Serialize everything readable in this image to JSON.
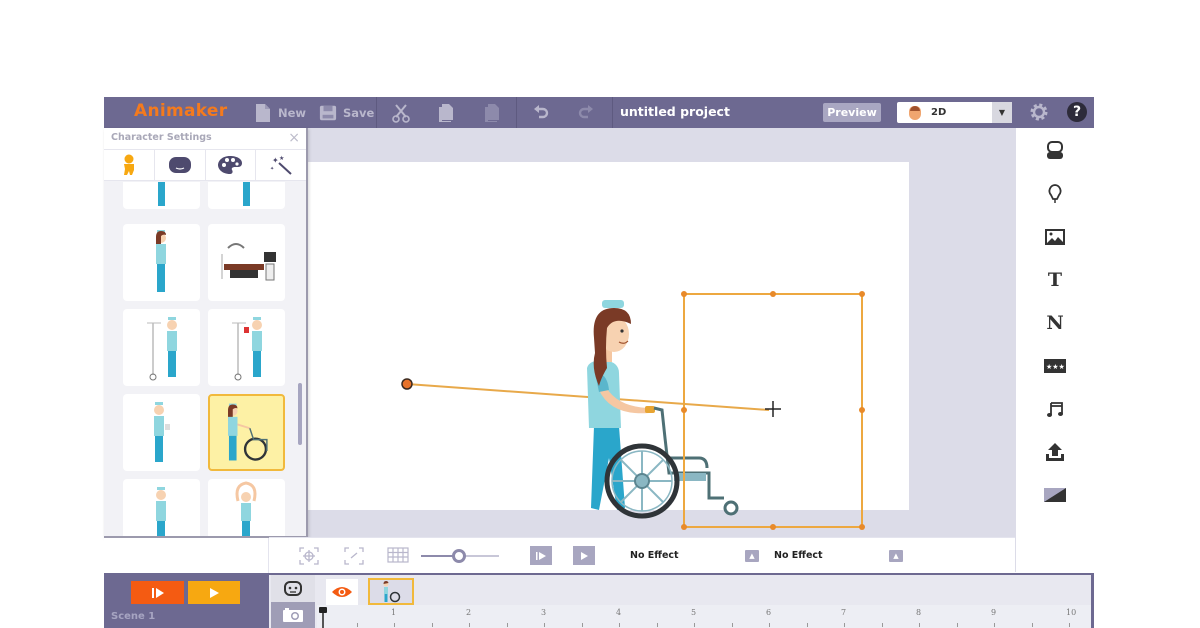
{
  "app": {
    "logo": "Animaker",
    "project_title": "untitled project",
    "colors": {
      "topbar": "#6d6991",
      "accent_orange": "#f45b12",
      "accent_yellow": "#f7a811",
      "selection": "#f1b93c"
    }
  },
  "toolbar": {
    "new_label": "New",
    "save_label": "Save",
    "cut_icon": "scissors-icon",
    "copy_icon": "copy-icon",
    "paste_icon": "paste-icon",
    "undo_icon": "undo-icon",
    "redo_icon": "redo-icon",
    "preview_label": "Preview",
    "mode_value": "2D",
    "settings_icon": "gear-icon",
    "help_label": "?"
  },
  "character_panel": {
    "title": "Character Settings",
    "close_label": "×",
    "tabs": [
      {
        "name": "actions",
        "icon": "character-icon"
      },
      {
        "name": "face",
        "icon": "face-icon"
      },
      {
        "name": "color",
        "icon": "palette-icon"
      },
      {
        "name": "effects",
        "icon": "magic-wand-icon"
      }
    ],
    "items": [
      {
        "label": "nurse standing legs (partial)",
        "selected": false
      },
      {
        "label": "nurse standing legs (partial)",
        "selected": false
      },
      {
        "label": "nurse standing",
        "selected": false
      },
      {
        "label": "operating room equipment",
        "selected": false
      },
      {
        "label": "nurse with IV stand",
        "selected": false
      },
      {
        "label": "nurse with IV stand holding item",
        "selected": false
      },
      {
        "label": "nurse holding cup",
        "selected": false
      },
      {
        "label": "nurse pushing wheelchair",
        "selected": true
      },
      {
        "label": "nurse writing",
        "selected": false
      },
      {
        "label": "nurse arms raised",
        "selected": false
      }
    ]
  },
  "right_sidebar": {
    "items": [
      {
        "name": "characters",
        "icon": "character-head-icon"
      },
      {
        "name": "props",
        "icon": "lightbulb-icon"
      },
      {
        "name": "backgrounds",
        "icon": "image-icon"
      },
      {
        "name": "text",
        "icon": "text-icon",
        "glyph": "T"
      },
      {
        "name": "numbers",
        "icon": "number-icon",
        "glyph": "N"
      },
      {
        "name": "effects",
        "icon": "stars-icon"
      },
      {
        "name": "music",
        "icon": "music-icon"
      },
      {
        "name": "upload",
        "icon": "upload-icon"
      },
      {
        "name": "transition",
        "icon": "transition-icon"
      }
    ]
  },
  "controls": {
    "enter_effect": "No Effect",
    "exit_effect": "No Effect",
    "zoom_level": 0.5
  },
  "timeline": {
    "scene_label": "Scene 1",
    "ticks": [
      "1",
      "2",
      "3",
      "4",
      "5",
      "6",
      "7",
      "8",
      "9",
      "10"
    ]
  }
}
